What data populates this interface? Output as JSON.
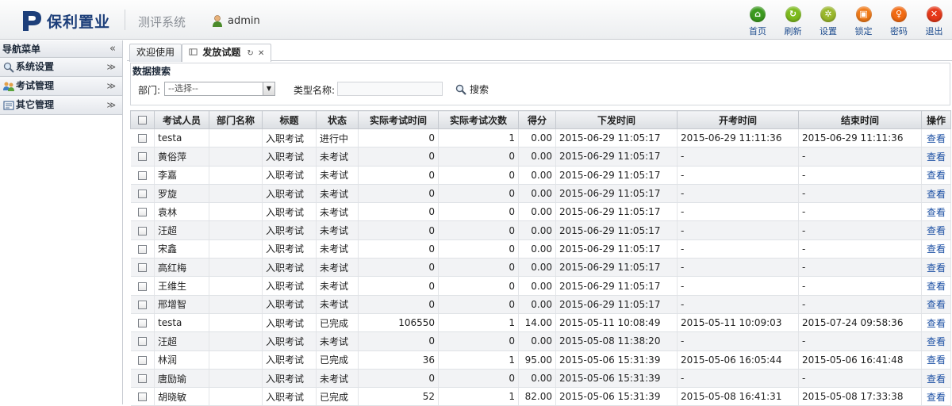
{
  "header": {
    "logo_text": "保利置业",
    "system_name": "测评系统",
    "user": "admin",
    "toolbar": [
      {
        "label": "首页",
        "icon": "home-icon",
        "color": "#3c9a1f"
      },
      {
        "label": "刷新",
        "icon": "refresh-icon",
        "color": "#7dbb1e"
      },
      {
        "label": "设置",
        "icon": "gear-icon",
        "color": "#9ab82c"
      },
      {
        "label": "锁定",
        "icon": "lock-icon",
        "color": "#f07a18"
      },
      {
        "label": "密码",
        "icon": "key-icon",
        "color": "#f26a12"
      },
      {
        "label": "退出",
        "icon": "close-icon",
        "color": "#e63819"
      }
    ]
  },
  "sidebar": {
    "title": "导航菜单",
    "items": [
      {
        "label": "系统设置",
        "icon": "search-settings-icon"
      },
      {
        "label": "考试管理",
        "icon": "users-icon"
      },
      {
        "label": "其它管理",
        "icon": "document-icon"
      }
    ]
  },
  "tabs": [
    {
      "label": "欢迎使用"
    },
    {
      "label": "发放试题",
      "active": true
    }
  ],
  "search": {
    "title": "数据搜索",
    "dept_label": "部门:",
    "dept_value": "--选择--",
    "type_label": "类型名称:",
    "type_value": "",
    "button_label": "搜索"
  },
  "table": {
    "columns": [
      "考试人员",
      "部门名称",
      "标题",
      "状态",
      "实际考试时间",
      "实际考试次数",
      "得分",
      "下发时间",
      "开考时间",
      "结束时间",
      "操作"
    ],
    "rows": [
      [
        "testa",
        "",
        "入职考试",
        "进行中",
        "0",
        "1",
        "0.00",
        "2015-06-29 11:05:17",
        "2015-06-29 11:11:36",
        "2015-06-29 11:11:36",
        "查看"
      ],
      [
        "黄俗萍",
        "",
        "入职考试",
        "未考试",
        "0",
        "0",
        "0.00",
        "2015-06-29 11:05:17",
        "-",
        "-",
        "查看"
      ],
      [
        "李嘉",
        "",
        "入职考试",
        "未考试",
        "0",
        "0",
        "0.00",
        "2015-06-29 11:05:17",
        "-",
        "-",
        "查看"
      ],
      [
        "罗旋",
        "",
        "入职考试",
        "未考试",
        "0",
        "0",
        "0.00",
        "2015-06-29 11:05:17",
        "-",
        "-",
        "查看"
      ],
      [
        "袁林",
        "",
        "入职考试",
        "未考试",
        "0",
        "0",
        "0.00",
        "2015-06-29 11:05:17",
        "-",
        "-",
        "查看"
      ],
      [
        "汪超",
        "",
        "入职考试",
        "未考试",
        "0",
        "0",
        "0.00",
        "2015-06-29 11:05:17",
        "-",
        "-",
        "查看"
      ],
      [
        "宋鑫",
        "",
        "入职考试",
        "未考试",
        "0",
        "0",
        "0.00",
        "2015-06-29 11:05:17",
        "-",
        "-",
        "查看"
      ],
      [
        "高红梅",
        "",
        "入职考试",
        "未考试",
        "0",
        "0",
        "0.00",
        "2015-06-29 11:05:17",
        "-",
        "-",
        "查看"
      ],
      [
        "王维生",
        "",
        "入职考试",
        "未考试",
        "0",
        "0",
        "0.00",
        "2015-06-29 11:05:17",
        "-",
        "-",
        "查看"
      ],
      [
        "邢增智",
        "",
        "入职考试",
        "未考试",
        "0",
        "0",
        "0.00",
        "2015-06-29 11:05:17",
        "-",
        "-",
        "查看"
      ],
      [
        "testa",
        "",
        "入职考试",
        "已完成",
        "106550",
        "1",
        "14.00",
        "2015-05-11 10:08:49",
        "2015-05-11 10:09:03",
        "2015-07-24 09:58:36",
        "查看"
      ],
      [
        "汪超",
        "",
        "入职考试",
        "未考试",
        "0",
        "0",
        "0.00",
        "2015-05-08 11:38:20",
        "-",
        "-",
        "查看"
      ],
      [
        "林润",
        "",
        "入职考试",
        "已完成",
        "36",
        "1",
        "95.00",
        "2015-05-06 15:31:39",
        "2015-05-06 16:05:44",
        "2015-05-06 16:41:48",
        "查看"
      ],
      [
        "唐励瑜",
        "",
        "入职考试",
        "未考试",
        "0",
        "0",
        "0.00",
        "2015-05-06 15:31:39",
        "-",
        "-",
        "查看"
      ],
      [
        "胡晓敏",
        "",
        "入职考试",
        "已完成",
        "52",
        "1",
        "82.00",
        "2015-05-06 15:31:39",
        "2015-05-08 16:41:31",
        "2015-05-08 17:33:38",
        "查看"
      ]
    ]
  }
}
